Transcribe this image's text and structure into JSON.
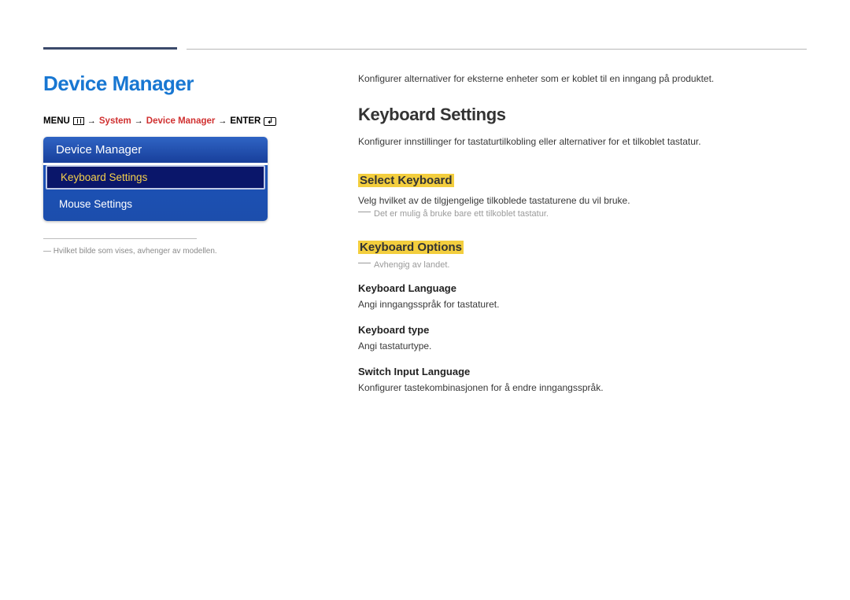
{
  "left": {
    "title": "Device Manager",
    "breadcrumb": {
      "menu": "MENU",
      "system": "System",
      "device_manager": "Device Manager",
      "enter": "ENTER"
    },
    "osd": {
      "header": "Device Manager",
      "items": [
        {
          "label": "Keyboard Settings",
          "selected": true
        },
        {
          "label": "Mouse Settings",
          "selected": false
        }
      ]
    },
    "footnote_dash": "―",
    "footnote": "Hvilket bilde som vises, avhenger av modellen."
  },
  "right": {
    "intro": "Konfigurer alternativer for eksterne enheter som er koblet til en inngang på produktet.",
    "section_title": "Keyboard Settings",
    "section_desc": "Konfigurer innstillinger for tastaturtilkobling eller alternativer for et tilkoblet tastatur.",
    "select_keyboard": {
      "title": "Select Keyboard",
      "desc": "Velg hvilket av de tilgjengelige tilkoblede tastaturene du vil bruke.",
      "note": "Det er mulig å bruke bare ett tilkoblet tastatur."
    },
    "keyboard_options": {
      "title": "Keyboard Options",
      "note": "Avhengig av landet.",
      "items": [
        {
          "title": "Keyboard Language",
          "desc": "Angi inngangsspråk for tastaturet."
        },
        {
          "title": "Keyboard type",
          "desc": "Angi tastaturtype."
        },
        {
          "title": "Switch Input Language",
          "desc": "Konfigurer tastekombinasjonen for å endre inngangsspråk."
        }
      ]
    }
  }
}
